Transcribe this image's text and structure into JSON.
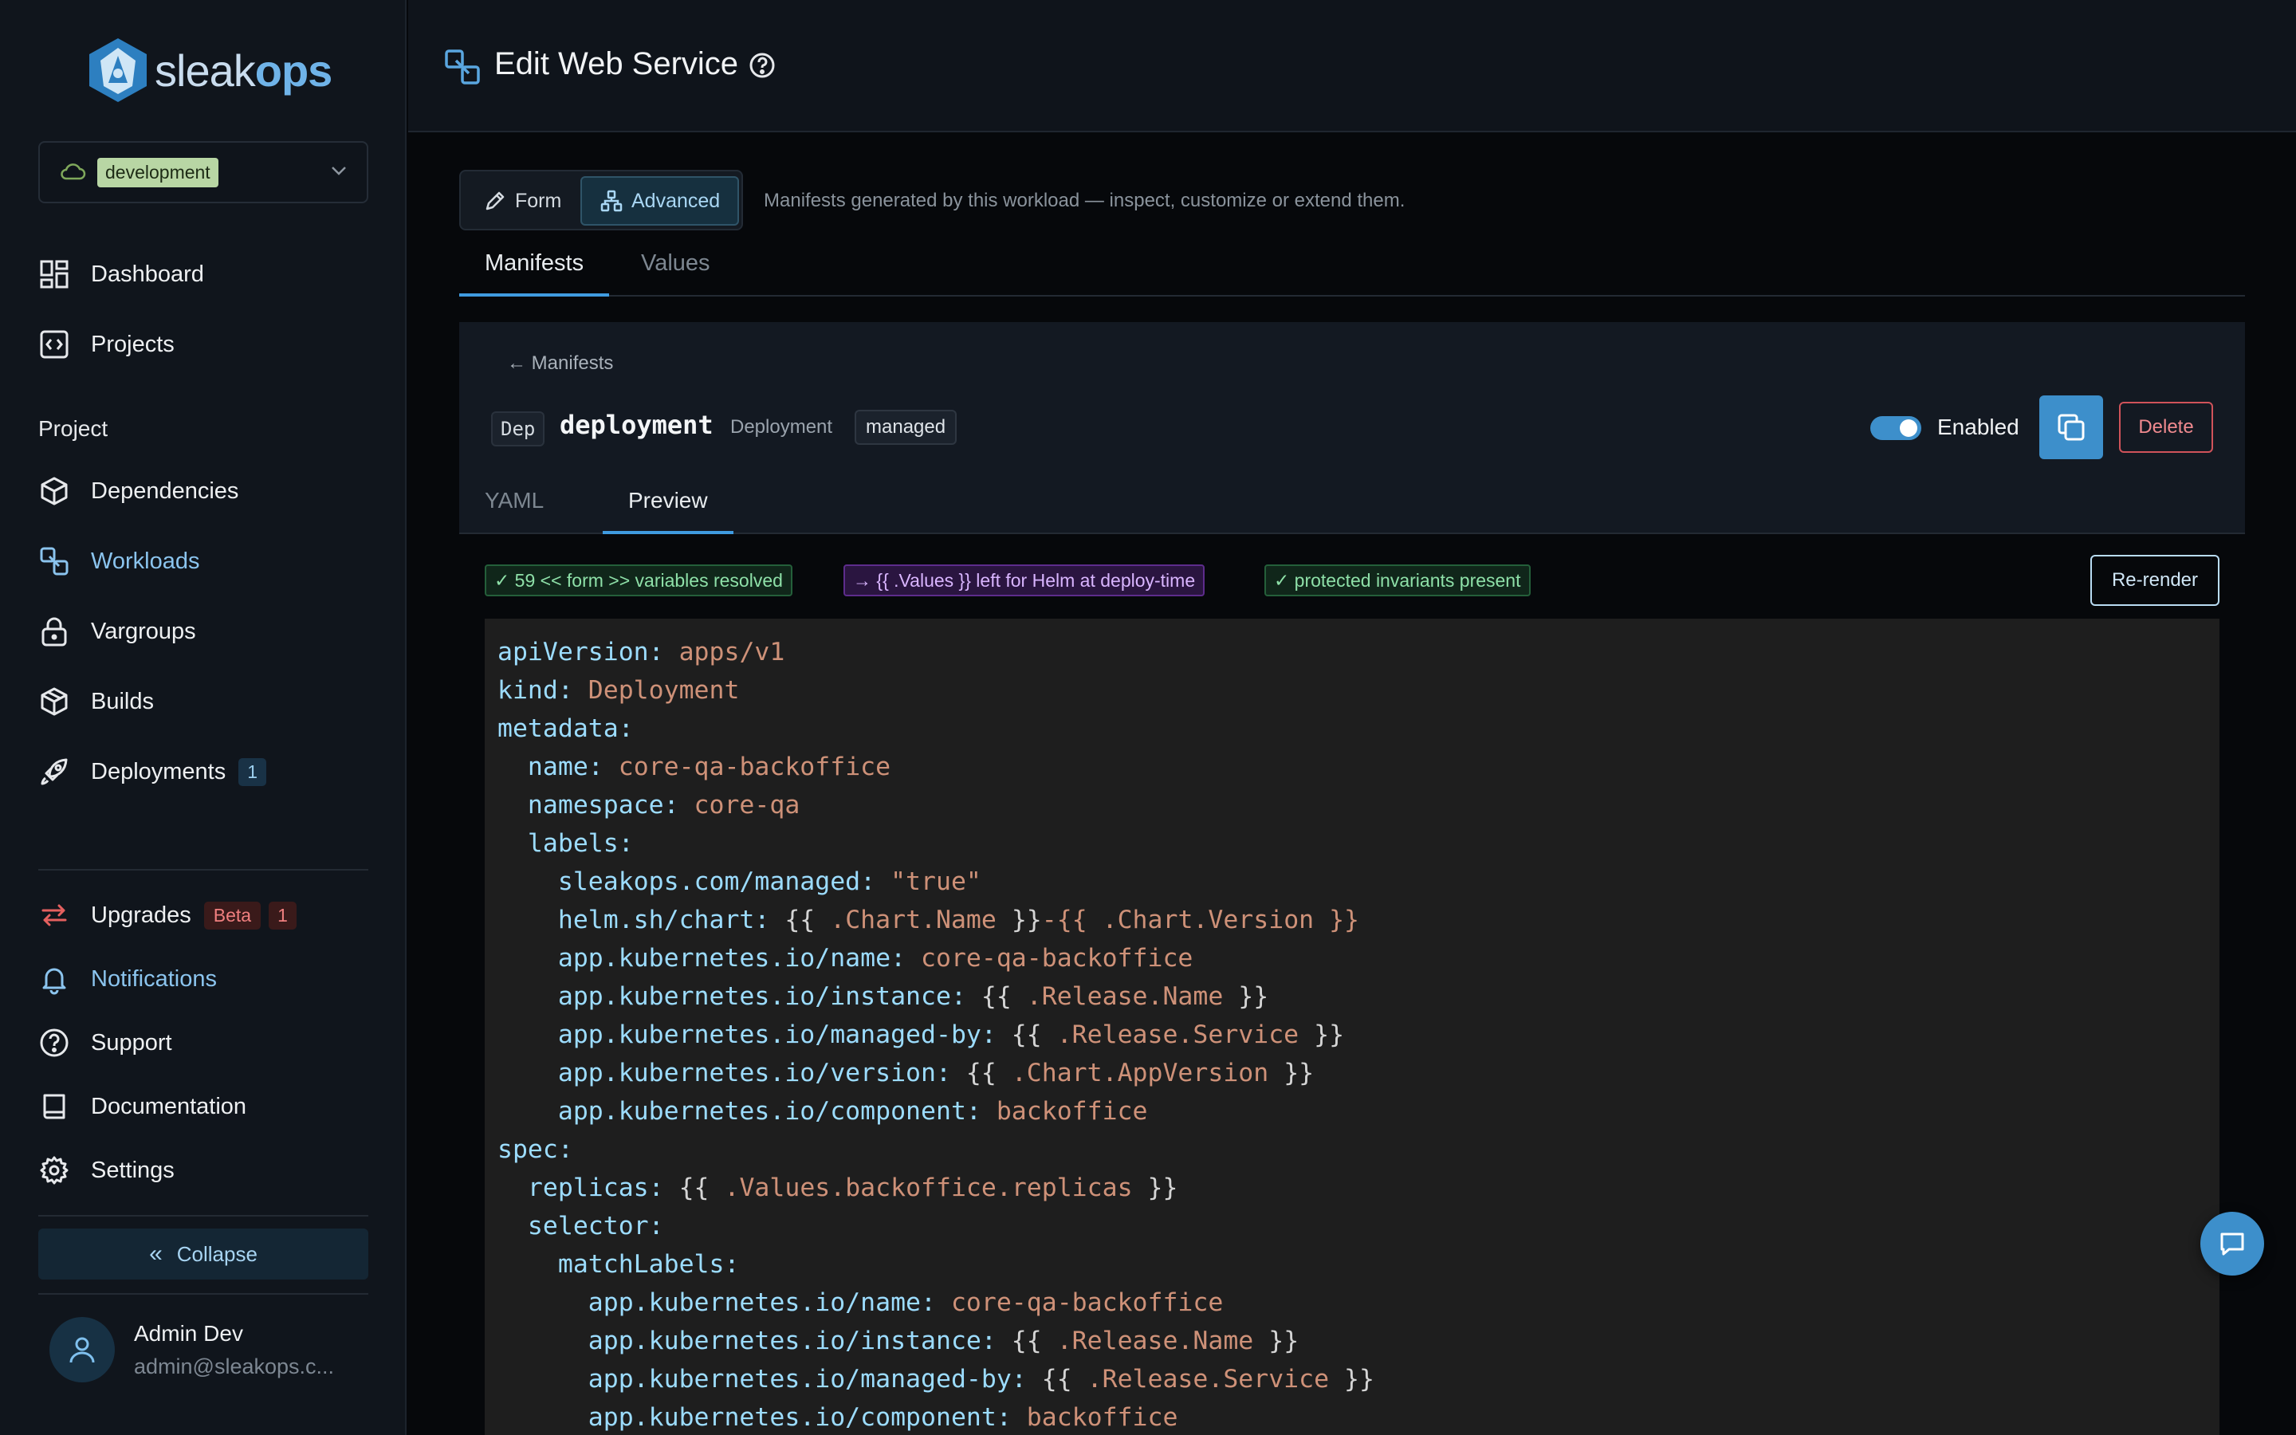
{
  "brand": {
    "name_light": "sleak",
    "name_bold": "ops"
  },
  "environment": {
    "selected": "development"
  },
  "nav": {
    "dashboard": "Dashboard",
    "projects": "Projects",
    "section_project": "Project",
    "dependencies": "Dependencies",
    "workloads": "Workloads",
    "vargroups": "Vargroups",
    "builds": "Builds",
    "deployments": "Deployments",
    "deployments_count": "1",
    "upgrades": "Upgrades",
    "upgrades_beta": "Beta",
    "upgrades_count": "1",
    "notifications": "Notifications",
    "support": "Support",
    "documentation": "Documentation",
    "settings": "Settings",
    "collapse": "Collapse"
  },
  "user": {
    "name": "Admin Dev",
    "email": "admin@sleakops.c..."
  },
  "header": {
    "title": "Edit Web Service"
  },
  "mode": {
    "form_label": "Form",
    "advanced_label": "Advanced",
    "hint": "Manifests generated by this workload — inspect, customize or extend them."
  },
  "tabs": {
    "manifests": "Manifests",
    "values": "Values"
  },
  "resource": {
    "back_label": "← Manifests",
    "kind_short": "Dep",
    "name": "deployment",
    "kind": "Deployment",
    "managed_label": "managed",
    "enabled_label": "Enabled",
    "enabled": true,
    "delete_label": "Delete"
  },
  "subtabs": {
    "yaml": "YAML",
    "preview": "Preview"
  },
  "status_chips": {
    "resolved": "✓ 59 << form >> variables resolved",
    "helm_left": "→ {{ .Values }} left for Helm at deploy-time",
    "invariants": "✓ protected invariants present"
  },
  "rerender_label": "Re-render",
  "colors": {
    "accent": "#3d8fcb",
    "code_key": "#9cdcfe",
    "code_value": "#ce9178"
  },
  "code_lines": [
    {
      "k": "apiVersion:",
      "v": " apps/v1"
    },
    {
      "k": "kind:",
      "v": " Deployment"
    },
    {
      "k": "metadata:"
    },
    {
      "k": "  name:",
      "v": " core-qa-backoffice"
    },
    {
      "k": "  namespace:",
      "v": " core-qa"
    },
    {
      "k": "  labels:"
    },
    {
      "k": "    sleakops.com/managed:",
      "v": " \"true\""
    },
    {
      "k": "    helm.sh/chart:",
      "p": " {{",
      "v": " .Chart.Name",
      "p2": " }}",
      "v2": "-{{ .Chart.Version }}"
    },
    {
      "k": "    app.kubernetes.io/name:",
      "v": " core-qa-backoffice"
    },
    {
      "k": "    app.kubernetes.io/instance:",
      "p": " {{",
      "v": " .Release.Name",
      "p2": " }}"
    },
    {
      "k": "    app.kubernetes.io/managed-by:",
      "p": " {{",
      "v": " .Release.Service",
      "p2": " }}"
    },
    {
      "k": "    app.kubernetes.io/version:",
      "p": " {{",
      "v": " .Chart.AppVersion",
      "p2": " }}"
    },
    {
      "k": "    app.kubernetes.io/component:",
      "v": " backoffice"
    },
    {
      "k": "spec:"
    },
    {
      "k": "  replicas:",
      "p": " {{",
      "v": " .Values.backoffice.replicas",
      "p2": " }}"
    },
    {
      "k": "  selector:"
    },
    {
      "k": "    matchLabels:"
    },
    {
      "k": "      app.kubernetes.io/name:",
      "v": " core-qa-backoffice"
    },
    {
      "k": "      app.kubernetes.io/instance:",
      "p": " {{",
      "v": " .Release.Name",
      "p2": " }}"
    },
    {
      "k": "      app.kubernetes.io/managed-by:",
      "p": " {{",
      "v": " .Release.Service",
      "p2": " }}"
    },
    {
      "k": "      app.kubernetes.io/component:",
      "v": " backoffice"
    }
  ]
}
